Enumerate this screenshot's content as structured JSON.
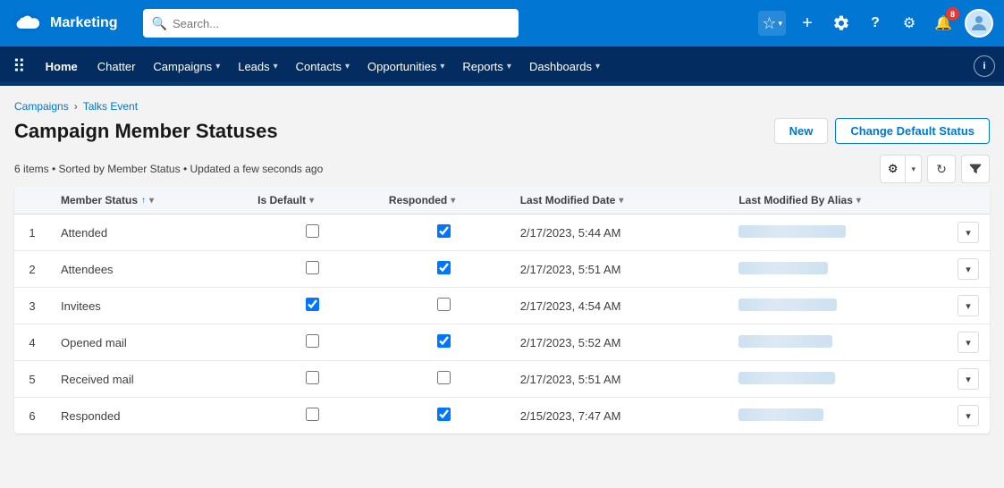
{
  "app": {
    "logo_alt": "Salesforce",
    "name": "Marketing"
  },
  "search": {
    "placeholder": "Search..."
  },
  "top_nav_icons": {
    "star": "★",
    "add": "+",
    "cloud": "☁",
    "help": "?",
    "gear": "⚙",
    "notifications": "🔔",
    "notification_count": "8",
    "info": "i"
  },
  "app_nav": {
    "home_label": "Home",
    "items": [
      {
        "label": "Chatter",
        "has_dropdown": false
      },
      {
        "label": "Campaigns",
        "has_dropdown": true
      },
      {
        "label": "Leads",
        "has_dropdown": true
      },
      {
        "label": "Contacts",
        "has_dropdown": true
      },
      {
        "label": "Opportunities",
        "has_dropdown": true
      },
      {
        "label": "Reports",
        "has_dropdown": true
      },
      {
        "label": "Dashboards",
        "has_dropdown": true
      }
    ]
  },
  "breadcrumb": {
    "items": [
      {
        "label": "Campaigns",
        "link": true
      },
      {
        "label": "Talks Event",
        "link": true
      }
    ]
  },
  "page": {
    "title": "Campaign Member Statuses",
    "meta": "6 items • Sorted by Member Status • Updated a few seconds ago",
    "btn_new": "New",
    "btn_change_default": "Change Default Status"
  },
  "table": {
    "columns": [
      {
        "label": "",
        "key": "row_num"
      },
      {
        "label": "Member Status",
        "key": "member_status",
        "sortable": true,
        "sort_dir": "asc",
        "has_col_menu": true
      },
      {
        "label": "Is Default",
        "key": "is_default",
        "has_col_menu": true
      },
      {
        "label": "Responded",
        "key": "responded",
        "has_col_menu": true
      },
      {
        "label": "Last Modified Date",
        "key": "last_modified_date",
        "has_col_menu": true
      },
      {
        "label": "Last Modified By Alias",
        "key": "last_modified_by",
        "has_col_menu": true
      },
      {
        "label": "",
        "key": "actions"
      }
    ],
    "rows": [
      {
        "num": 1,
        "member_status": "Attended",
        "is_default": false,
        "responded": true,
        "last_modified_date": "2/17/2023, 5:44 AM",
        "alias_width": 120
      },
      {
        "num": 2,
        "member_status": "Attendees",
        "is_default": false,
        "responded": true,
        "last_modified_date": "2/17/2023, 5:51 AM",
        "alias_width": 100
      },
      {
        "num": 3,
        "member_status": "Invitees",
        "is_default": true,
        "responded": false,
        "last_modified_date": "2/17/2023, 4:54 AM",
        "alias_width": 110
      },
      {
        "num": 4,
        "member_status": "Opened mail",
        "is_default": false,
        "responded": true,
        "last_modified_date": "2/17/2023, 5:52 AM",
        "alias_width": 105
      },
      {
        "num": 5,
        "member_status": "Received mail",
        "is_default": false,
        "responded": false,
        "last_modified_date": "2/17/2023, 5:51 AM",
        "alias_width": 108
      },
      {
        "num": 6,
        "member_status": "Responded",
        "is_default": false,
        "responded": true,
        "last_modified_date": "2/15/2023, 7:47 AM",
        "alias_width": 95
      }
    ]
  }
}
